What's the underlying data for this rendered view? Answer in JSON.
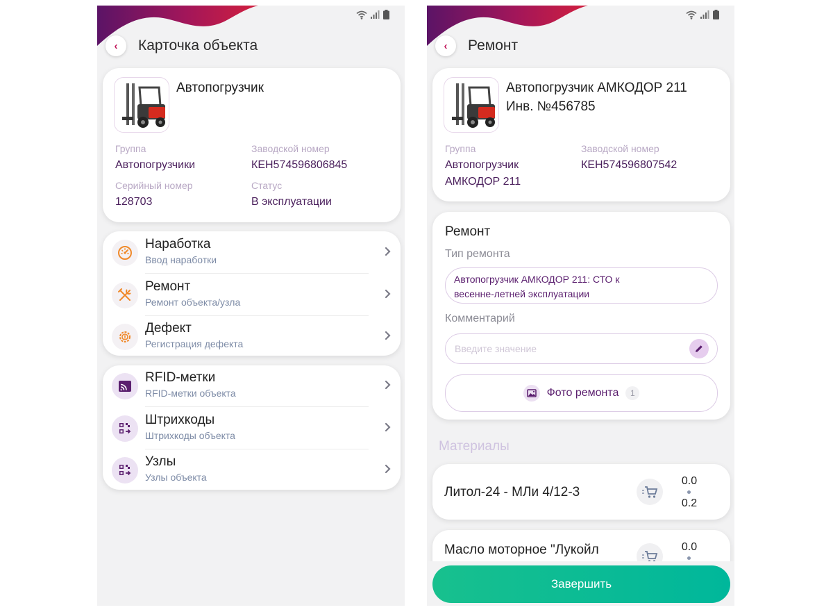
{
  "left": {
    "header": {
      "title": "Карточка объекта"
    },
    "object": {
      "name": "Автопогрузчик",
      "fields": [
        {
          "label": "Группа",
          "value": "Автопогрузчики"
        },
        {
          "label": "Заводской номер",
          "value": "КЕН574596806845"
        },
        {
          "label": "Серийный номер",
          "value": "128703"
        },
        {
          "label": "Статус",
          "value": "В эксплуатации"
        }
      ]
    },
    "menu_groups": [
      [
        {
          "title": "Наработка",
          "subtitle": "Ввод наработки",
          "icon": "speedometer-icon"
        },
        {
          "title": "Ремонт",
          "subtitle": "Ремонт объекта/узла",
          "icon": "tools-icon"
        },
        {
          "title": "Дефект",
          "subtitle": "Регистрация дефекта",
          "icon": "gear-warning-icon"
        }
      ],
      [
        {
          "title": "RFID-метки",
          "subtitle": "RFID-метки объекта",
          "icon": "rfid-icon"
        },
        {
          "title": "Штрихкоды",
          "subtitle": "Штрихкоды объекта",
          "icon": "barcode-icon"
        },
        {
          "title": "Узлы",
          "subtitle": "Узлы объекта",
          "icon": "nodes-icon"
        }
      ]
    ]
  },
  "right": {
    "header": {
      "title": "Ремонт"
    },
    "object": {
      "name_line1": "Автопогрузчик АМКОДОР 211",
      "name_line2": "Инв. №456785",
      "fields": [
        {
          "label": "Группа",
          "value_line1": "Автопогрузчик",
          "value_line2": "АМКОДОР 211"
        },
        {
          "label": "Заводской номер",
          "value_line1": "КЕН574596807542"
        }
      ]
    },
    "repair": {
      "title": "Ремонт",
      "type_label": "Тип ремонта",
      "type_value_line1": "Автопогрузчик АМКОДОР 211: СТО к",
      "type_value_line2": "весенне-летней эксплуатации",
      "comment_label": "Комментарий",
      "comment_placeholder": "Введите значение",
      "photo_label": "Фото ремонта",
      "photo_count": "1"
    },
    "materials": {
      "title": "Материалы",
      "items": [
        {
          "name": "Литол-24 - МЛи 4/12-3",
          "qty_top": "0.0",
          "qty_bottom": "0.2"
        },
        {
          "name": "Масло моторное \"Лукойл",
          "qty_top": "0.0",
          "qty_bottom": ""
        }
      ]
    },
    "finish_label": "Завершить"
  },
  "colors": {
    "accent": "#5a1e6e",
    "brand_red": "#c2185b",
    "finish_green": "#18c08e",
    "icon_orange": "#f0892a"
  }
}
